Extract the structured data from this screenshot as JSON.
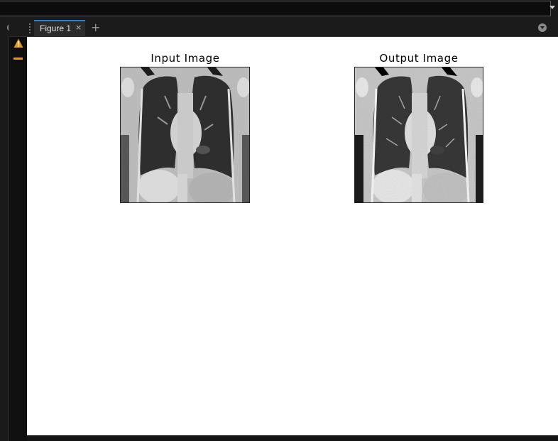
{
  "figure_tab": {
    "label": "Figure 1",
    "close_glyph": "×",
    "add_glyph": "+"
  },
  "address_bar": {
    "value": "",
    "dropdown_icon": "chevron-down-icon"
  },
  "gutter": {
    "warning_icon": "warning-triangle-icon",
    "warning_color": "#e8961c",
    "warning_dash_icon": "minus-icon"
  },
  "axes": [
    {
      "title": "Input Image",
      "content": "chest CT coronal slice, grayscale"
    },
    {
      "title": "Output Image",
      "content": "contrast-enhanced chest CT coronal slice, grayscale"
    }
  ],
  "colors": {
    "tab_accent": "#2d7fd1",
    "background_dark": "#141414",
    "canvas": "#ffffff"
  }
}
